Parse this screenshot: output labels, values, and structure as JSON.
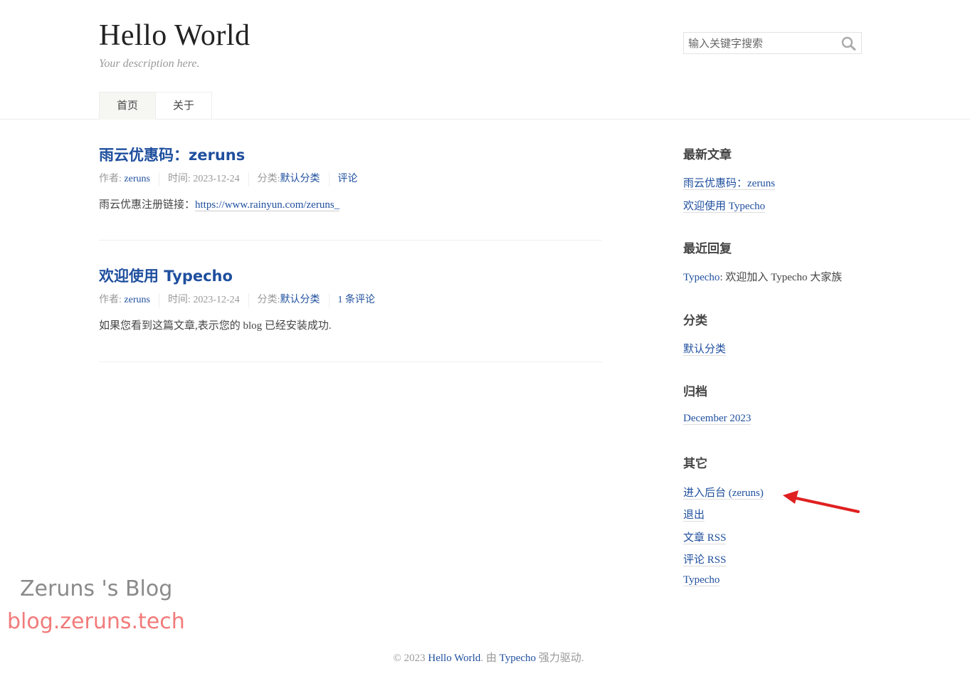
{
  "header": {
    "title": "Hello World",
    "description": "Your description here.",
    "search_placeholder": "输入关键字搜索"
  },
  "nav": [
    {
      "label": "首页",
      "current": true
    },
    {
      "label": "关于",
      "current": false
    }
  ],
  "posts": [
    {
      "title": "雨云优惠码：zeruns",
      "author_label": "作者:",
      "author": "zeruns",
      "time_label": "时间:",
      "time": "2023-12-24",
      "category_label": "分类:",
      "category": "默认分类",
      "comments": "评论",
      "body_text": "雨云优惠注册链接：",
      "body_link": "https://www.rainyun.com/zeruns_"
    },
    {
      "title": "欢迎使用 Typecho",
      "author_label": "作者:",
      "author": "zeruns",
      "time_label": "时间:",
      "time": "2023-12-24",
      "category_label": "分类:",
      "category": "默认分类",
      "comments": "1 条评论",
      "body_text": "如果您看到这篇文章,表示您的 blog 已经安装成功."
    }
  ],
  "sidebar": {
    "recent_posts": {
      "title": "最新文章",
      "items": [
        "雨云优惠码：zeruns",
        "欢迎使用 Typecho"
      ]
    },
    "recent_comments": {
      "title": "最近回复",
      "items": [
        {
          "author": "Typecho",
          "text": ": 欢迎加入 Typecho 大家族"
        }
      ]
    },
    "categories": {
      "title": "分类",
      "items": [
        "默认分类"
      ]
    },
    "archives": {
      "title": "归档",
      "items": [
        "December 2023"
      ]
    },
    "other": {
      "title": "其它",
      "items": [
        "进入后台 (zeruns)",
        "退出",
        "文章 RSS",
        "评论 RSS",
        "Typecho"
      ]
    }
  },
  "watermark": {
    "name": "Zeruns 's Blog",
    "url": "blog.zeruns.tech"
  },
  "footer": {
    "copyright": "© 2023 ",
    "site": "Hello World",
    "middle": ". 由 ",
    "powered": "Typecho",
    "end": " 强力驱动."
  },
  "colors": {
    "link": "#1f4f9e",
    "annotation_arrow": "#e02020",
    "watermark_url": "#f27a7a"
  }
}
